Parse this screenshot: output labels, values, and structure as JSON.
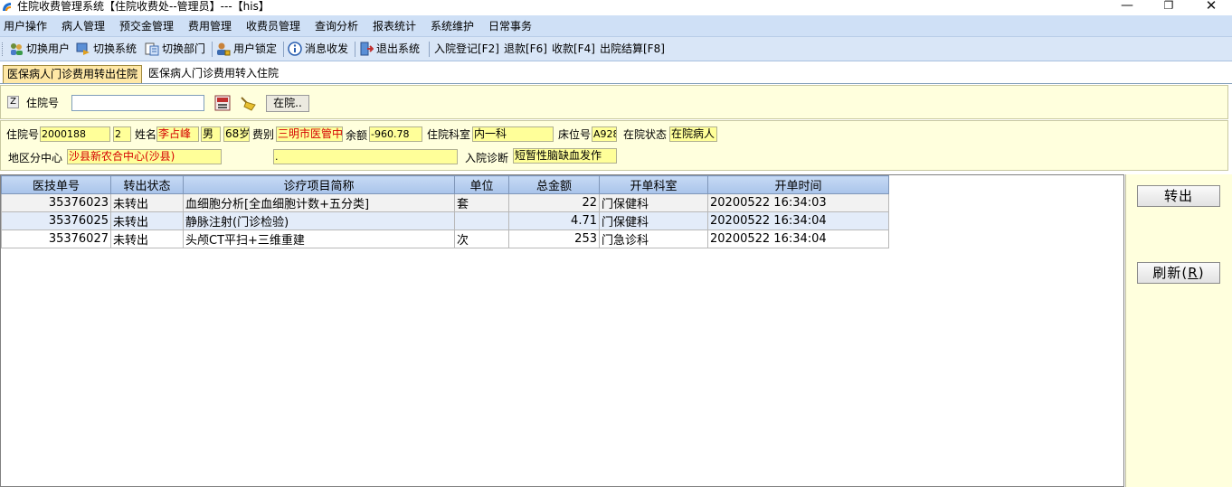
{
  "window": {
    "title": "住院收费管理系统【住院收费处--管理员】---【his】",
    "controls": {
      "minimize": "—",
      "maximize": "❐",
      "close": "✕"
    }
  },
  "menu": [
    "用户操作",
    "病人管理",
    "预交金管理",
    "费用管理",
    "收费员管理",
    "查询分析",
    "报表统计",
    "系统维护",
    "日常事务"
  ],
  "toolbar": {
    "switch_user": "切换用户",
    "switch_system": "切换系统",
    "switch_dept": "切换部门",
    "lock_user": "用户锁定",
    "messages": "消息收发",
    "exit_system": "退出系统",
    "admission": "入院登记[F2]",
    "refund": "退款[F6]",
    "collect": "收款[F4]",
    "discharge": "出院结算[F8]"
  },
  "tabs": {
    "active": "医保病人门诊费用转出住院",
    "inactive": "医保病人门诊费用转入住院"
  },
  "search": {
    "z_button": "Z",
    "label": "住院号",
    "input_value": "",
    "status_button": "在院.."
  },
  "patient": {
    "admission_no_label": "住院号",
    "admission_no": "2000188",
    "visit_count": "2",
    "name_label": "姓名",
    "name": "李占峰",
    "gender": "男",
    "age": "68岁",
    "fee_type_label": "费别",
    "fee_type": "三明市医管中",
    "balance_label": "余额",
    "balance": "-960.78",
    "dept_label": "住院科室",
    "dept": "内一科",
    "bed_label": "床位号",
    "bed": "A928",
    "status_label": "在院状态",
    "status": "在院病人",
    "region_label": "地区分中心",
    "region": "沙县新农合中心(沙县)",
    "region_extra": ".",
    "diagnosis_label": "入院诊断",
    "diagnosis": "短暂性脑缺血发作"
  },
  "grid": {
    "columns": [
      "医技单号",
      "转出状态",
      "诊疗项目简称",
      "单位",
      "总金额",
      "开单科室",
      "开单时间"
    ],
    "rows": [
      [
        "35376023",
        "未转出",
        "血细胞分析[全血细胞计数+五分类]",
        "套",
        "22",
        "门保健科",
        "20200522 16:34:03"
      ],
      [
        "35376025",
        "未转出",
        "静脉注射(门诊检验)",
        "",
        "4.71",
        "门保健科",
        "20200522 16:34:04"
      ],
      [
        "35376027",
        "未转出",
        "头颅CT平扫+三维重建",
        "次",
        "253",
        "门急诊科",
        "20200522 16:34:04"
      ]
    ]
  },
  "actions": {
    "transfer_out": "转出",
    "refresh": "刷新",
    "refresh_hotkey_open": "(",
    "refresh_hotkey": "R",
    "refresh_hotkey_close": ")"
  }
}
